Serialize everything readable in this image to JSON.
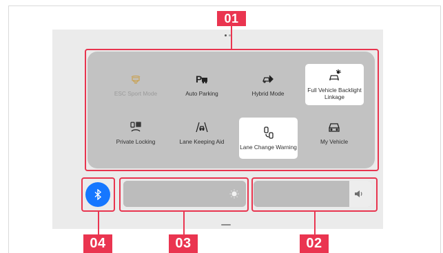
{
  "tiles": [
    {
      "label": "ESC Sport Mode",
      "icon": "esc-sport-mode-icon",
      "state": "disabled"
    },
    {
      "label": "Auto Parking",
      "icon": "auto-parking-icon",
      "state": "normal"
    },
    {
      "label": "Hybrid Mode",
      "icon": "hybrid-mode-icon",
      "state": "normal"
    },
    {
      "label": "Full Vehicle Backlight Linkage",
      "icon": "backlight-car-icon",
      "state": "active"
    },
    {
      "label": "Private Locking",
      "icon": "private-locking-icon",
      "state": "normal"
    },
    {
      "label": "Lane Keeping Aid",
      "icon": "lane-keeping-icon",
      "state": "normal"
    },
    {
      "label": "Lane Change Warning",
      "icon": "lane-change-warning-icon",
      "state": "active"
    },
    {
      "label": "My Vehicle",
      "icon": "my-vehicle-icon",
      "state": "normal"
    }
  ],
  "bluetooth": {
    "icon": "bluetooth-icon",
    "state": "on"
  },
  "brightness": {
    "icon": "sun-icon",
    "level": 0.94
  },
  "volume": {
    "icon": "speaker-icon",
    "level": 0.81
  },
  "callouts": [
    "01",
    "02",
    "03",
    "04"
  ],
  "colors": {
    "highlight": "#e8344e",
    "accent": "#1677ff",
    "active_tile": "#ffffff",
    "panel": "#c2c2c2"
  }
}
